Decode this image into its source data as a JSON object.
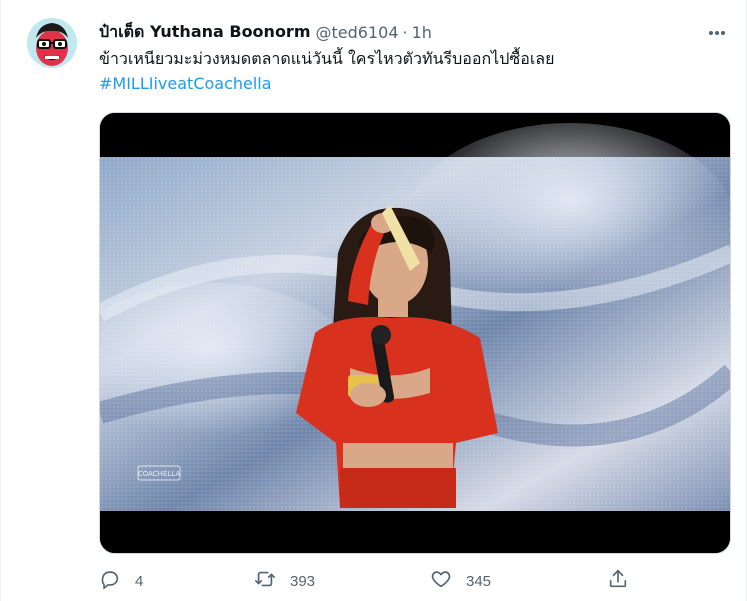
{
  "tweet": {
    "display_name": "ป๋าเต็ด Yuthana Boonorm",
    "handle": "@ted6104",
    "separator": "·",
    "time": "1h",
    "text": "ข้าวเหนียวมะม่วงหมดตลาดแน่วันนี้ ใครไหวตัวทันรีบออกไปซื้อเลย",
    "hashtag": "#MILLIiveatCoachella",
    "hashtag_color": "#1d9bf0"
  },
  "media": {
    "watermark": "COACHELLA"
  },
  "actions": {
    "reply_icon": "reply-icon",
    "reply_count": "4",
    "retweet_icon": "retweet-icon",
    "retweet_count": "393",
    "like_icon": "heart-icon",
    "like_count": "345",
    "share_icon": "share-icon"
  },
  "colors": {
    "text_primary": "#0f1419",
    "text_secondary": "#536471",
    "link": "#1d9bf0"
  }
}
